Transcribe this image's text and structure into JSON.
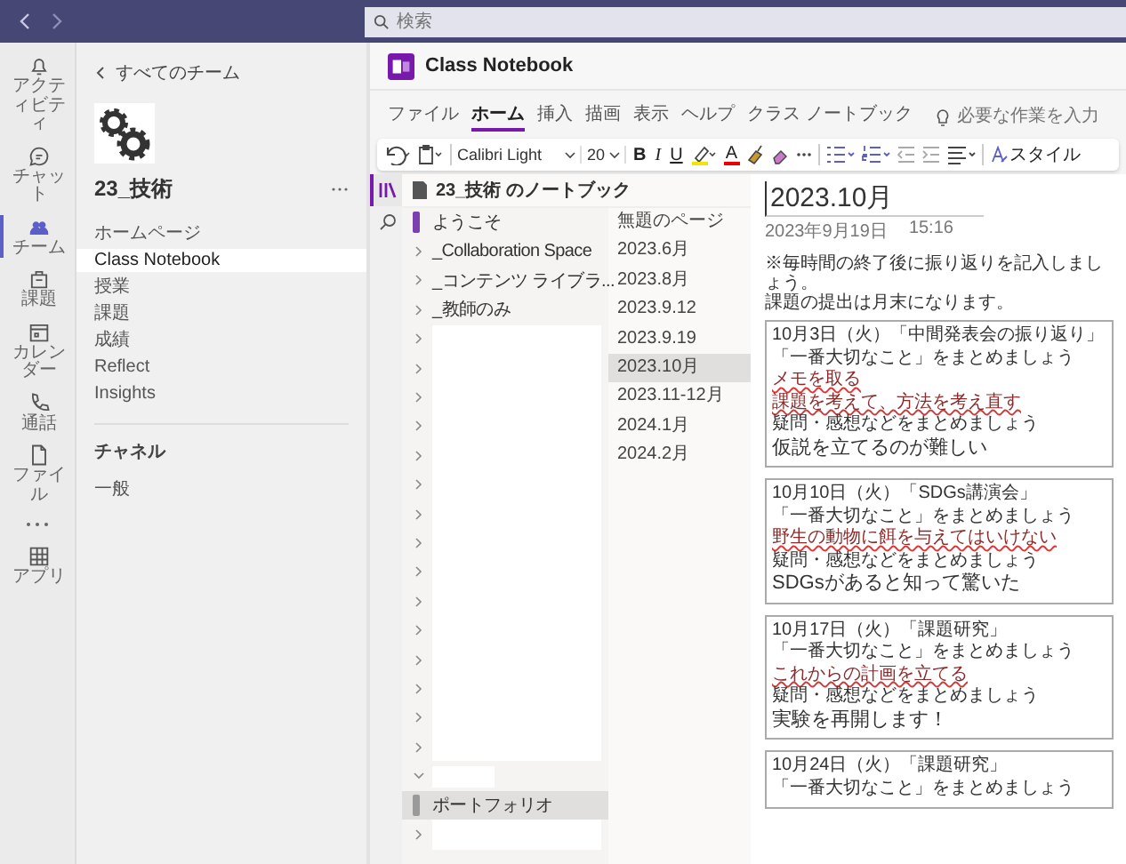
{
  "top_bar": {
    "search": {
      "placeholder": "検索"
    }
  },
  "rail": [
    {
      "label": "アクティビティ",
      "selected": false
    },
    {
      "label": "チャット",
      "selected": false
    },
    {
      "label": "チーム",
      "selected": true
    },
    {
      "label": "課題",
      "selected": false
    },
    {
      "label": "カレンダー",
      "selected": false
    },
    {
      "label": "通話",
      "selected": false
    },
    {
      "label": "ファイル",
      "selected": false
    },
    {
      "label": "アプリ",
      "selected": false
    }
  ],
  "team_panel": {
    "back_link": "すべてのチーム",
    "team_name": "23_技術",
    "nav": [
      {
        "label": "ホームページ",
        "selected": false
      },
      {
        "label": "Class Notebook",
        "selected": true
      },
      {
        "label": "授業",
        "selected": false
      },
      {
        "label": "課題",
        "selected": false
      },
      {
        "label": "成績",
        "selected": false
      },
      {
        "label": "Reflect",
        "selected": false
      },
      {
        "label": "Insights",
        "selected": false
      }
    ],
    "channels_heading": "チャネル",
    "channels": [
      "一般"
    ]
  },
  "app_header": {
    "title": "Class Notebook"
  },
  "menu_tabs": [
    {
      "label": "ファイル",
      "selected": false
    },
    {
      "label": "ホーム",
      "selected": true
    },
    {
      "label": "挿入",
      "selected": false
    },
    {
      "label": "描画",
      "selected": false
    },
    {
      "label": "表示",
      "selected": false
    },
    {
      "label": "ヘルプ",
      "selected": false
    },
    {
      "label": "クラス ノートブック",
      "selected": false
    }
  ],
  "tell_me": {
    "placeholder": "必要な作業を入力"
  },
  "toolbar": {
    "font": "Calibri Light",
    "size": "20",
    "bold": "B",
    "italic": "I",
    "underline": "U",
    "font_color": "A",
    "styles": "スタイル"
  },
  "notebook": {
    "title": "23_技術 のノートブック",
    "sections": [
      {
        "kind": "section",
        "name": "ようこそ",
        "color": "#7b3fb0",
        "selected": false
      },
      {
        "kind": "group",
        "name": "_Collaboration Space",
        "expanded": false,
        "selected": false
      },
      {
        "kind": "group",
        "name": "_コンテンツ ライブラ...",
        "expanded": false,
        "selected": false
      },
      {
        "kind": "group",
        "name": "_教師のみ",
        "expanded": false,
        "selected": false
      },
      {
        "kind": "group",
        "expanded": false,
        "selected": false
      },
      {
        "kind": "group",
        "expanded": false,
        "selected": false
      },
      {
        "kind": "group",
        "expanded": false,
        "selected": false
      },
      {
        "kind": "group",
        "expanded": false,
        "selected": false
      },
      {
        "kind": "group",
        "expanded": false,
        "selected": false
      },
      {
        "kind": "group",
        "expanded": false,
        "selected": false
      },
      {
        "kind": "group",
        "expanded": false,
        "selected": false
      },
      {
        "kind": "group",
        "expanded": false,
        "selected": false
      },
      {
        "kind": "group",
        "expanded": false,
        "selected": false
      },
      {
        "kind": "group",
        "expanded": false,
        "selected": false
      },
      {
        "kind": "group",
        "expanded": false,
        "selected": false
      },
      {
        "kind": "group",
        "expanded": false,
        "selected": false
      },
      {
        "kind": "group",
        "expanded": false,
        "selected": false
      },
      {
        "kind": "group",
        "expanded": false,
        "selected": false
      },
      {
        "kind": "group",
        "expanded": false,
        "selected": false
      },
      {
        "kind": "group",
        "expanded": true,
        "selected": false
      },
      {
        "kind": "section",
        "name": "ポートフォリオ",
        "color": "#9a9a9a",
        "selected": true
      },
      {
        "kind": "group",
        "expanded": false,
        "selected": false
      }
    ],
    "pages": [
      {
        "title": "無題のページ",
        "selected": false
      },
      {
        "title": "2023.6月",
        "selected": false
      },
      {
        "title": "2023.8月",
        "selected": false
      },
      {
        "title": "2023.9.12",
        "selected": false
      },
      {
        "title": "2023.9.19",
        "selected": false
      },
      {
        "title": "2023.10月",
        "selected": true
      },
      {
        "title": "2023.11-12月",
        "selected": false
      },
      {
        "title": "2024.1月",
        "selected": false
      },
      {
        "title": "2024.2月",
        "selected": false
      }
    ]
  },
  "page": {
    "title": "2023.10月",
    "date": "2023年9月19日",
    "time": "15:16",
    "instructions": [
      "※毎時間の終了後に振り返りを記入しましょう。",
      "課題の提出は月末になります。"
    ],
    "notes": [
      {
        "lines": [
          {
            "kind": "heading",
            "text": "10月3日（火）「中間発表会の振り返り」"
          },
          {
            "kind": "prompt",
            "text": "「一番大切なこと」をまとめましょう"
          },
          {
            "kind": "marked",
            "text": "メモを取る"
          },
          {
            "kind": "marked",
            "text": "課題を考えて、方法を考え直す"
          },
          {
            "kind": "prompt",
            "text": "疑問・感想などをまとめましょう"
          },
          {
            "kind": "answer",
            "text": "仮説を立てるのが難しい"
          }
        ]
      },
      {
        "lines": [
          {
            "kind": "heading",
            "text": "10月10日（火）「SDGs講演会」"
          },
          {
            "kind": "prompt",
            "text": "「一番大切なこと」をまとめましょう"
          },
          {
            "kind": "marked",
            "text": "野生の動物に餌を与えてはいけない"
          },
          {
            "kind": "prompt",
            "text": "疑問・感想などをまとめましょう"
          },
          {
            "kind": "answer",
            "text": "SDGsがあると知って驚いた"
          }
        ]
      },
      {
        "lines": [
          {
            "kind": "heading",
            "text": "10月17日（火）「課題研究」"
          },
          {
            "kind": "prompt",
            "text": "「一番大切なこと」をまとめましょう"
          },
          {
            "kind": "marked",
            "text": "これからの計画を立てる"
          },
          {
            "kind": "prompt",
            "text": "疑問・感想などをまとめましょう"
          },
          {
            "kind": "answer",
            "text": "実験を再開します！"
          }
        ]
      },
      {
        "lines": [
          {
            "kind": "heading",
            "text": "10月24日（火）「課題研究」"
          },
          {
            "kind": "prompt",
            "text": "「一番大切なこと」をまとめましょう"
          }
        ]
      }
    ]
  }
}
